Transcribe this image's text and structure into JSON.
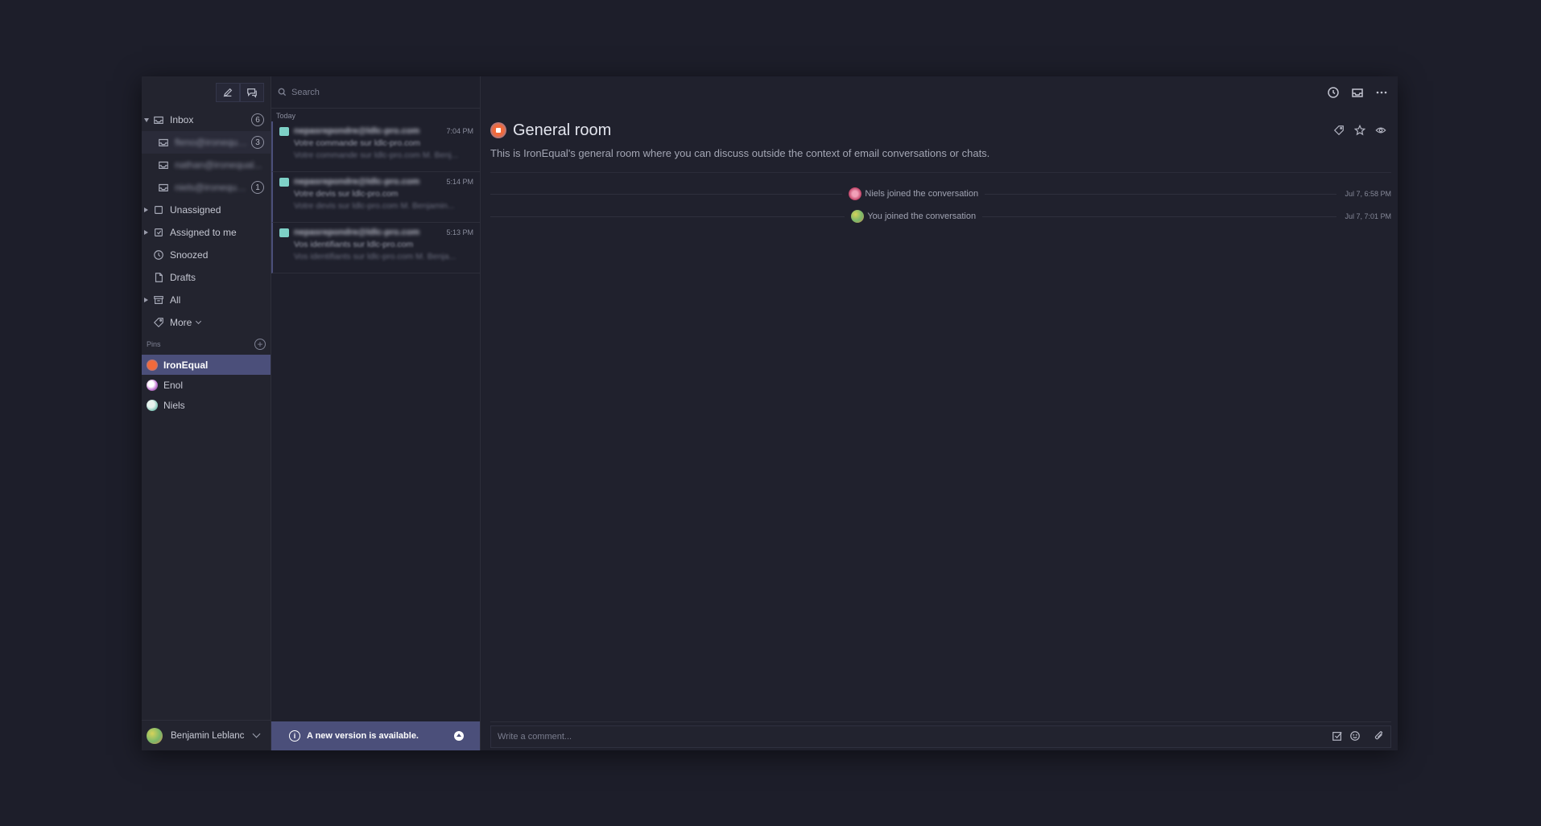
{
  "sidebar": {
    "inbox": {
      "label": "Inbox",
      "count": "6"
    },
    "accounts": [
      {
        "label": "fleno@ironequal...",
        "count": "3"
      },
      {
        "label": "nathan@ironequal...",
        "count": ""
      },
      {
        "label": "niels@ironequal...",
        "count": "1"
      }
    ],
    "items": [
      {
        "label": "Unassigned"
      },
      {
        "label": "Assigned to me"
      },
      {
        "label": "Snoozed"
      },
      {
        "label": "Drafts"
      },
      {
        "label": "All"
      },
      {
        "label": "More"
      }
    ],
    "pins_label": "Pins",
    "pins": [
      {
        "label": "IronEqual"
      },
      {
        "label": "Enol"
      },
      {
        "label": "Niels"
      }
    ],
    "user": {
      "name": "Benjamin Leblanc"
    }
  },
  "list": {
    "search": {
      "placeholder": "Search"
    },
    "group": "Today",
    "messages": [
      {
        "from": "nepasrepondre@ldlc-pro.com",
        "time": "7:04 PM",
        "subject": "Votre commande sur ldlc-pro.com",
        "preview": "Votre commande sur ldlc-pro.com M. Benj..."
      },
      {
        "from": "nepasrepondre@ldlc-pro.com",
        "time": "5:14 PM",
        "subject": "Votre devis sur ldlc-pro.com",
        "preview": "Votre devis sur ldlc-pro.com M. Benjamin..."
      },
      {
        "from": "nepasrepondre@ldlc-pro.com",
        "time": "5:13 PM",
        "subject": "Vos identifiants sur ldlc-pro.com",
        "preview": "Vos identifiants sur ldlc-pro.com M. Benja..."
      }
    ],
    "update_notice": "A new version is available."
  },
  "main": {
    "room_title": "General room",
    "room_description": "This is IronEqual's general room where you can discuss outside the context of email conversations or chats.",
    "events": [
      {
        "text": "Niels joined the conversation",
        "time": "Jul 7, 6:58 PM"
      },
      {
        "text": "You joined the conversation",
        "time": "Jul 7, 7:01 PM"
      }
    ],
    "composer": {
      "placeholder": "Write a comment..."
    }
  },
  "colors": {
    "accent": "#4b4f7a",
    "background": "#1d1e2a",
    "mail_icon": "#7ed1c7",
    "room_avatar": "#f26a3b"
  }
}
